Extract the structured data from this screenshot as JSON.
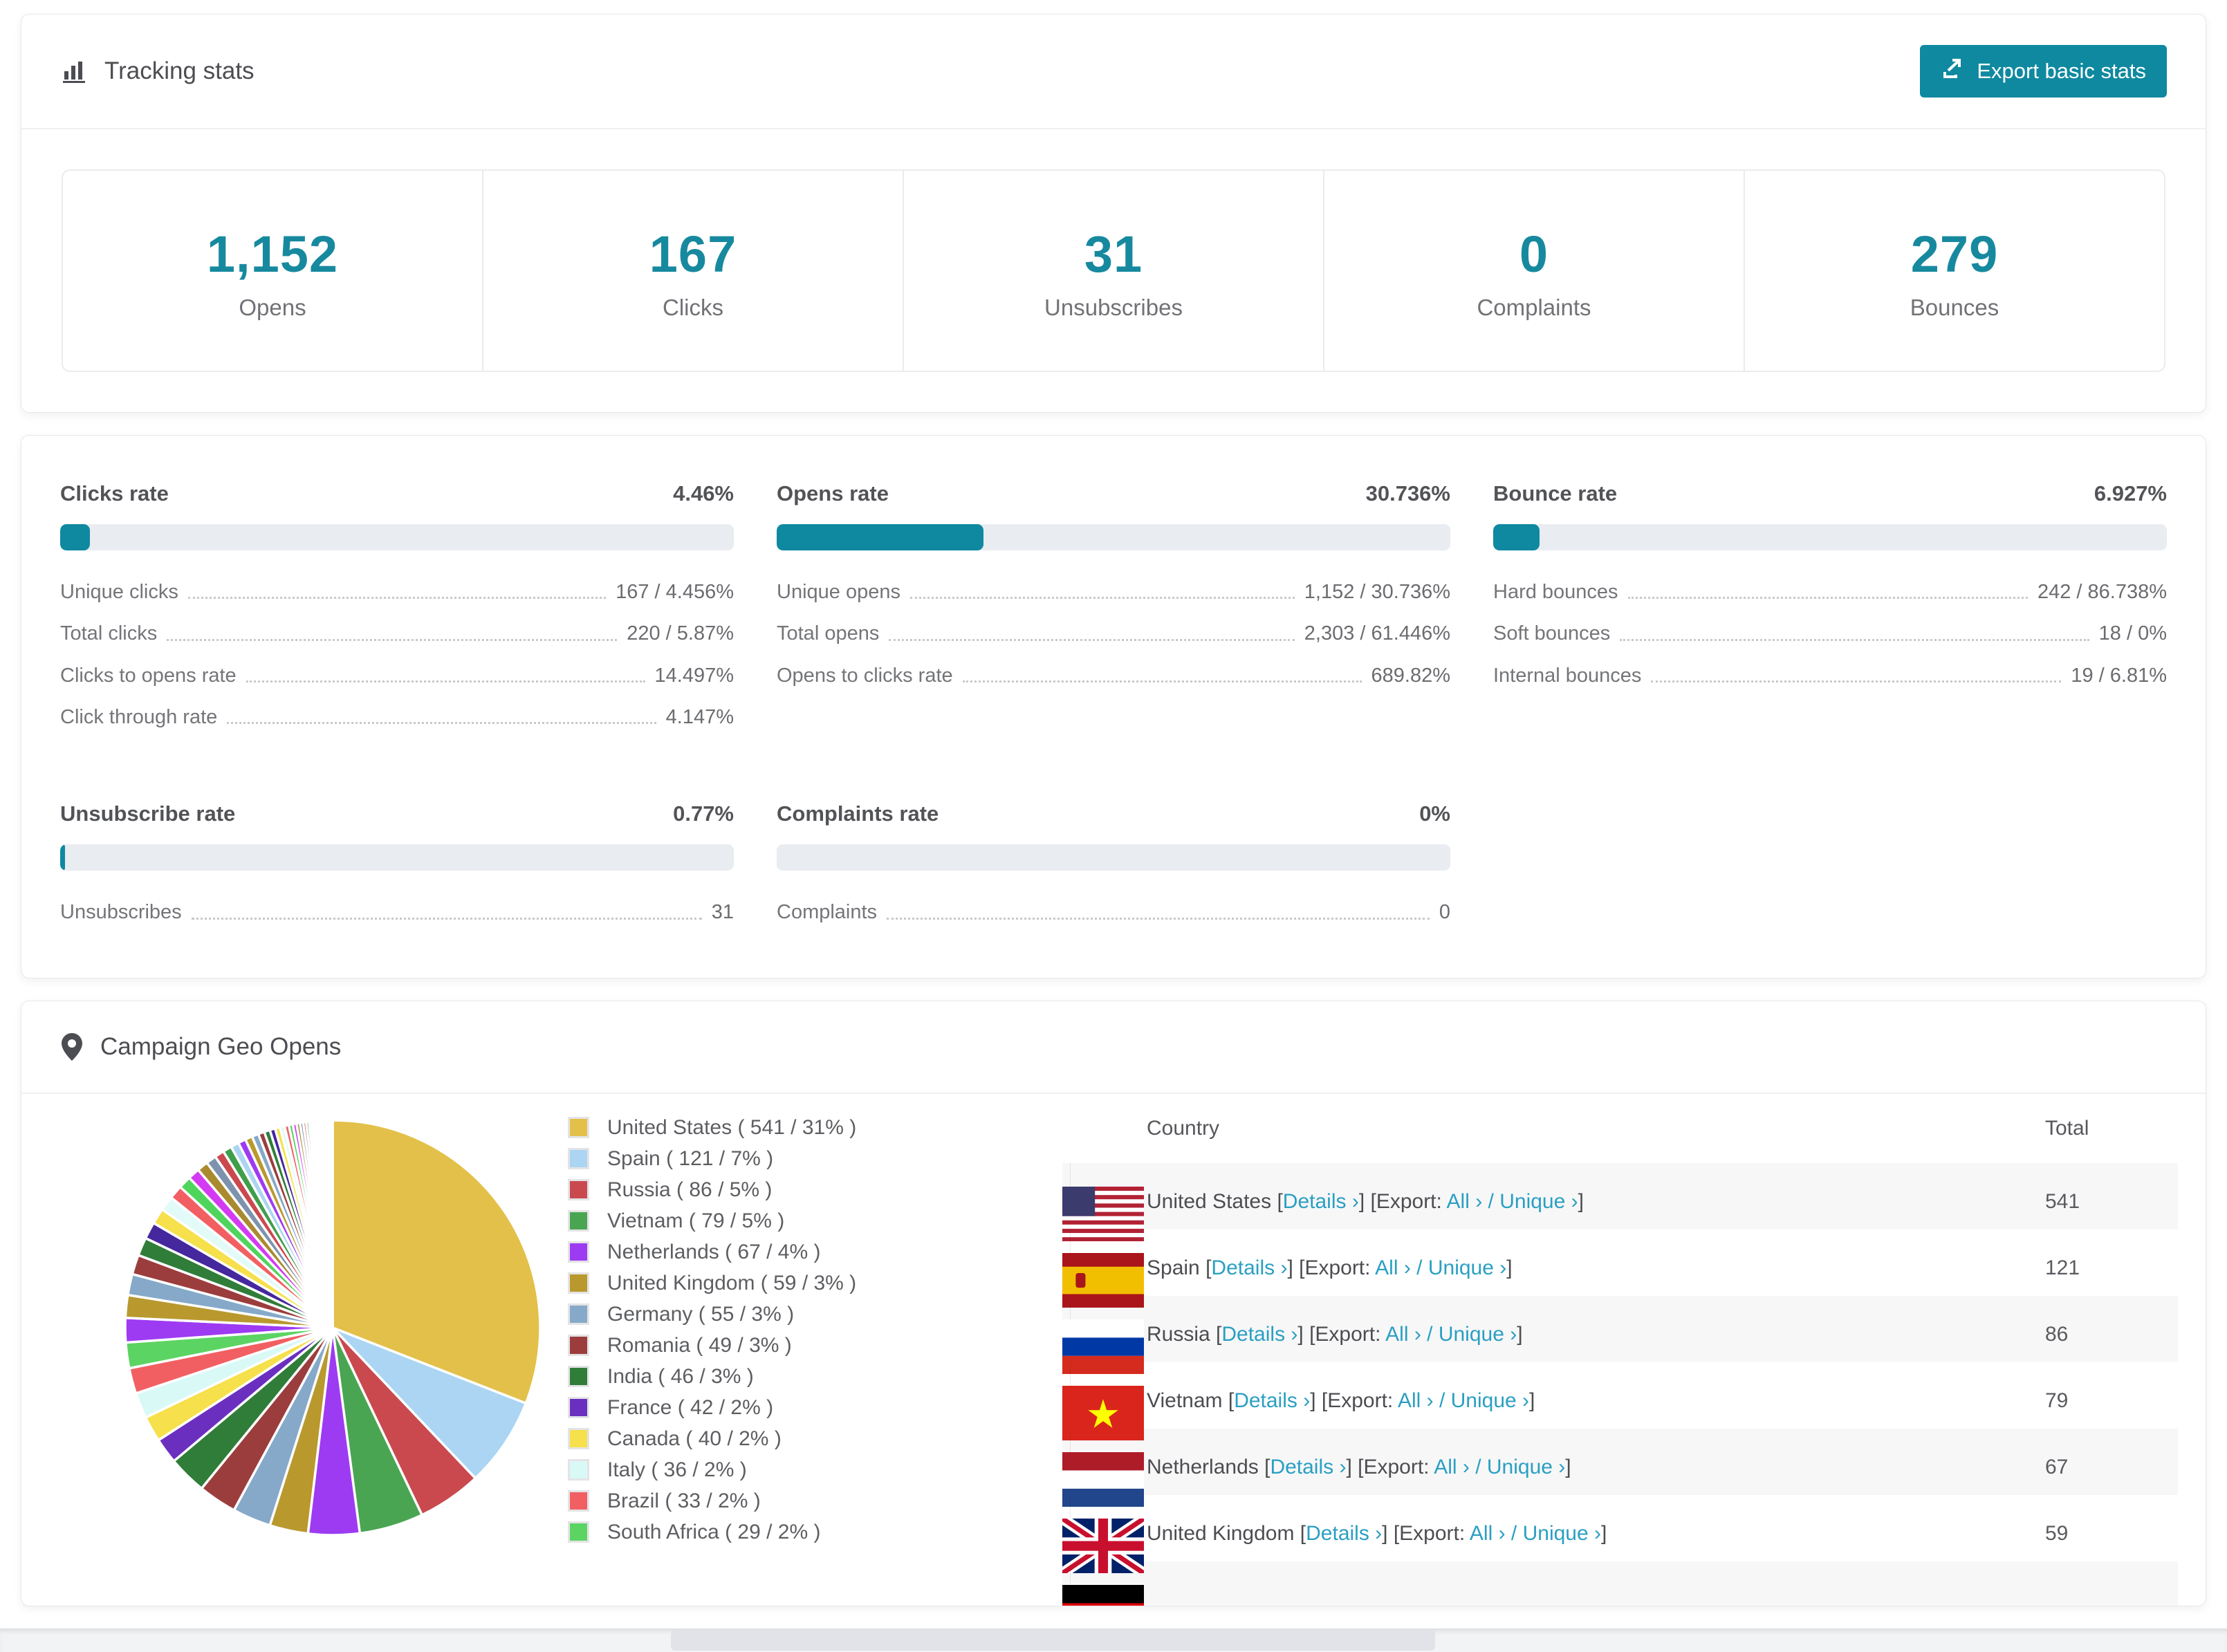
{
  "tracking": {
    "title": "Tracking stats",
    "export_button": "Export basic stats",
    "summary": [
      {
        "value": "1,152",
        "label": "Opens"
      },
      {
        "value": "167",
        "label": "Clicks"
      },
      {
        "value": "31",
        "label": "Unsubscribes"
      },
      {
        "value": "0",
        "label": "Complaints"
      },
      {
        "value": "279",
        "label": "Bounces"
      }
    ]
  },
  "rates": [
    {
      "title": "Clicks rate",
      "value": "4.46%",
      "percent": 4.46,
      "rows": [
        {
          "label": "Unique clicks",
          "value": "167 / 4.456%"
        },
        {
          "label": "Total clicks",
          "value": "220 / 5.87%"
        },
        {
          "label": "Clicks to opens rate",
          "value": "14.497%"
        },
        {
          "label": "Click through rate",
          "value": "4.147%"
        }
      ]
    },
    {
      "title": "Opens rate",
      "value": "30.736%",
      "percent": 30.736,
      "rows": [
        {
          "label": "Unique opens",
          "value": "1,152 / 30.736%"
        },
        {
          "label": "Total opens",
          "value": "2,303 / 61.446%"
        },
        {
          "label": "Opens to clicks rate",
          "value": "689.82%"
        }
      ]
    },
    {
      "title": "Bounce rate",
      "value": "6.927%",
      "percent": 6.927,
      "rows": [
        {
          "label": "Hard bounces",
          "value": "242 / 86.738%"
        },
        {
          "label": "Soft bounces",
          "value": "18 / 0%"
        },
        {
          "label": "Internal bounces",
          "value": "19 / 6.81%"
        }
      ]
    },
    {
      "title": "Unsubscribe rate",
      "value": "0.77%",
      "percent": 0.77,
      "rows": [
        {
          "label": "Unsubscribes",
          "value": "31"
        }
      ]
    },
    {
      "title": "Complaints rate",
      "value": "0%",
      "percent": 0,
      "rows": [
        {
          "label": "Complaints",
          "value": "0"
        }
      ]
    }
  ],
  "geo": {
    "title": "Campaign Geo Opens",
    "table_columns": [
      "Country",
      "Total"
    ],
    "link_details": "Details ›",
    "link_export_label": "Export:",
    "link_all": "All ›",
    "link_unique": "Unique ›",
    "rows": [
      {
        "country": "United States",
        "flag": "us",
        "total": "541",
        "partial": false
      },
      {
        "country": "Spain",
        "flag": "es",
        "total": "121",
        "partial": false
      },
      {
        "country": "Russia",
        "flag": "ru",
        "total": "86",
        "partial": false
      },
      {
        "country": "Vietnam",
        "flag": "vn",
        "total": "79",
        "partial": false
      },
      {
        "country": "Netherlands",
        "flag": "nl",
        "total": "67",
        "partial": false
      },
      {
        "country": "United Kingdom",
        "flag": "gb",
        "total": "59",
        "partial": false
      },
      {
        "country": "",
        "flag": "de",
        "total": "",
        "partial": true
      }
    ]
  },
  "chart_data": {
    "type": "pie",
    "title": "Campaign Geo Opens",
    "legend_position": "right",
    "series": [
      {
        "name": "United States",
        "count": 541,
        "pct": 31,
        "color": "#e3c04a"
      },
      {
        "name": "Spain",
        "count": 121,
        "pct": 7,
        "color": "#abd5f2"
      },
      {
        "name": "Russia",
        "count": 86,
        "pct": 5,
        "color": "#c9494f"
      },
      {
        "name": "Vietnam",
        "count": 79,
        "pct": 5,
        "color": "#4aa552"
      },
      {
        "name": "Netherlands",
        "count": 67,
        "pct": 4,
        "color": "#9d3bf2"
      },
      {
        "name": "United Kingdom",
        "count": 59,
        "pct": 3,
        "color": "#b9992e"
      },
      {
        "name": "Germany",
        "count": 55,
        "pct": 3,
        "color": "#86a9c9"
      },
      {
        "name": "Romania",
        "count": 49,
        "pct": 3,
        "color": "#9c3d3d"
      },
      {
        "name": "India",
        "count": 46,
        "pct": 3,
        "color": "#2f7d39"
      },
      {
        "name": "France",
        "count": 42,
        "pct": 2,
        "color": "#6b2fc0"
      },
      {
        "name": "Canada",
        "count": 40,
        "pct": 2,
        "color": "#f6e04b"
      },
      {
        "name": "Italy",
        "count": 36,
        "pct": 2,
        "color": "#d9f9f6"
      },
      {
        "name": "Brazil",
        "count": 33,
        "pct": 2,
        "color": "#f15f63"
      },
      {
        "name": "South Africa",
        "count": 29,
        "pct": 2,
        "color": "#5cd463"
      }
    ],
    "others_values": [
      1.9,
      1.77,
      1.64,
      1.53,
      1.42,
      1.32,
      1.23,
      1.15,
      1.07,
      0.99,
      0.92,
      0.86,
      0.8,
      0.74,
      0.69,
      0.64,
      0.6,
      0.56,
      0.52,
      0.48,
      0.45,
      0.42,
      0.39,
      0.36,
      0.34,
      0.31,
      0.29,
      0.27,
      0.25,
      0.23,
      0.22,
      0.2,
      0.19,
      0.18,
      0.16,
      0.15,
      0.14,
      0.13,
      0.12,
      0.11,
      0.1,
      0.1,
      0.09,
      0.08,
      0.08
    ]
  }
}
